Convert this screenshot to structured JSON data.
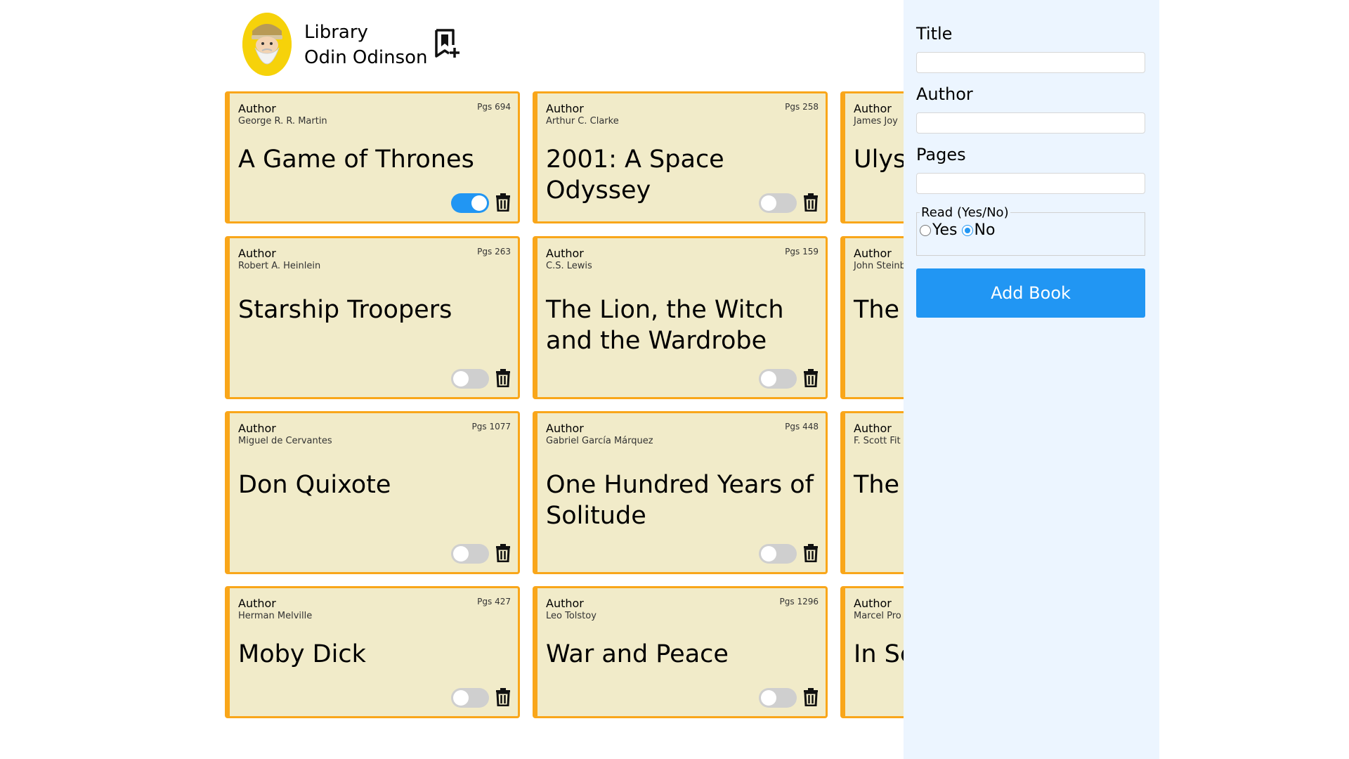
{
  "header": {
    "library_label": "Library",
    "user_name": "Odin Odinson"
  },
  "books": [
    {
      "author_label": "Author",
      "author": "George R. R. Martin",
      "pages": "Pgs 694",
      "title": "A Game of Thrones",
      "read": true
    },
    {
      "author_label": "Author",
      "author": "Arthur C. Clarke",
      "pages": "Pgs 258",
      "title": "2001: A Space Odyssey",
      "read": false
    },
    {
      "author_label": "Author",
      "author": "James Joy",
      "pages": "",
      "title": "Ulys",
      "read": false
    },
    {
      "author_label": "Author",
      "author": "Robert A. Heinlein",
      "pages": "Pgs 263",
      "title": "Starship Troopers",
      "read": false
    },
    {
      "author_label": "Author",
      "author": "C.S. Lewis",
      "pages": "Pgs 159",
      "title": "The Lion, the Witch and the Wardrobe",
      "read": false
    },
    {
      "author_label": "Author",
      "author": "John Steinb",
      "pages": "",
      "title": "The",
      "read": false
    },
    {
      "author_label": "Author",
      "author": "Miguel de Cervantes",
      "pages": "Pgs 1077",
      "title": "Don Quixote",
      "read": false
    },
    {
      "author_label": "Author",
      "author": "Gabriel García Márquez",
      "pages": "Pgs 448",
      "title": "One Hundred Years of Solitude",
      "read": false
    },
    {
      "author_label": "Author",
      "author": "F. Scott Fit",
      "pages": "",
      "title": "The",
      "read": false
    },
    {
      "author_label": "Author",
      "author": "Herman Melville",
      "pages": "Pgs 427",
      "title": "Moby Dick",
      "read": false
    },
    {
      "author_label": "Author",
      "author": "Leo Tolstoy",
      "pages": "Pgs 1296",
      "title": "War and Peace",
      "read": false
    },
    {
      "author_label": "Author",
      "author": "Marcel Pro",
      "pages": "",
      "title": "In Se",
      "read": false
    }
  ],
  "form": {
    "title_label": "Title",
    "author_label": "Author",
    "pages_label": "Pages",
    "read_legend": "Read (Yes/No)",
    "yes_label": "Yes",
    "no_label": "No",
    "selected_read": "No",
    "submit_label": "Add Book",
    "title_value": "",
    "author_value": "",
    "pages_value": ""
  },
  "colors": {
    "card_bg": "#f1ebc9",
    "card_border": "#f9a61a",
    "accent": "#2196f3",
    "sidebar_bg": "#ecf5ff",
    "avatar_bg": "#f6d20a"
  },
  "icons": {
    "header_action": "bookmark-add-icon",
    "card_delete": "trash-icon",
    "avatar": "bearded-viking-avatar"
  }
}
